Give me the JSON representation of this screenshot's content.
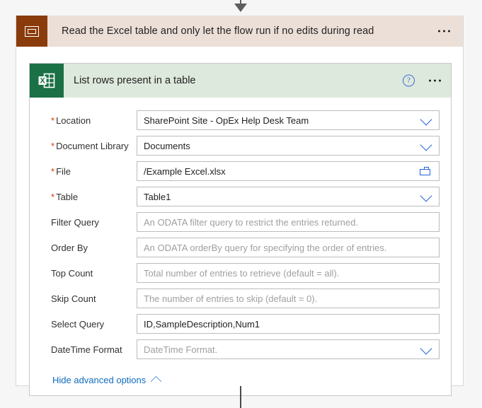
{
  "scope": {
    "title": "Read the Excel table and only let the flow run if no edits during read",
    "icon": "scope-icon",
    "menu_icon": "ellipsis-icon",
    "header_color": "#ecdfd8",
    "icon_color": "#8a3b0b"
  },
  "action_card": {
    "title": "List rows present in a table",
    "icon": "excel-icon",
    "help_icon": "?",
    "menu_icon": "ellipsis-icon",
    "header_color": "#dde9dd",
    "icon_color": "#1b7045",
    "fields": [
      {
        "label": "Location",
        "required": true,
        "value": "SharePoint Site - OpEx Help Desk Team",
        "placeholder": "",
        "control": "dropdown"
      },
      {
        "label": "Document Library",
        "required": true,
        "value": "Documents",
        "placeholder": "",
        "control": "dropdown"
      },
      {
        "label": "File",
        "required": true,
        "value": "/Example Excel.xlsx",
        "placeholder": "",
        "control": "file-picker"
      },
      {
        "label": "Table",
        "required": true,
        "value": "Table1",
        "placeholder": "",
        "control": "dropdown"
      },
      {
        "label": "Filter Query",
        "required": false,
        "value": "",
        "placeholder": "An ODATA filter query to restrict the entries returned.",
        "control": "text"
      },
      {
        "label": "Order By",
        "required": false,
        "value": "",
        "placeholder": "An ODATA orderBy query for specifying the order of entries.",
        "control": "text"
      },
      {
        "label": "Top Count",
        "required": false,
        "value": "",
        "placeholder": "Total number of entries to retrieve (default = all).",
        "control": "text"
      },
      {
        "label": "Skip Count",
        "required": false,
        "value": "",
        "placeholder": "The number of entries to skip (default = 0).",
        "control": "text"
      },
      {
        "label": "Select Query",
        "required": false,
        "value": "ID,SampleDescription,Num1",
        "placeholder": "",
        "control": "text"
      },
      {
        "label": "DateTime Format",
        "required": false,
        "value": "",
        "placeholder": "DateTime Format.",
        "control": "dropdown"
      }
    ],
    "advanced_toggle": {
      "label": "Hide advanced options",
      "chevron": "chevron-up-icon",
      "link_color": "#0f6cbd"
    }
  },
  "connectors": {
    "top_arrow": "arrow-down-icon",
    "bottom_line": "connector-line"
  }
}
